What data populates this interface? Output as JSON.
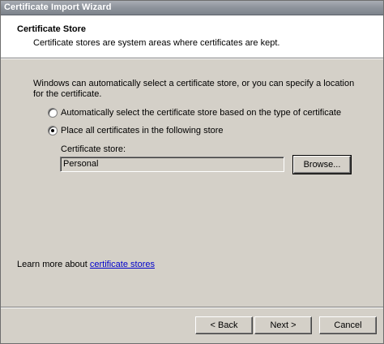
{
  "window": {
    "title": "Certificate Import Wizard"
  },
  "header": {
    "title": "Certificate Store",
    "description": "Certificate stores are system areas where certificates are kept."
  },
  "main": {
    "intro": "Windows can automatically select a certificate store, or you can specify a location for the certificate.",
    "options": [
      {
        "label": "Automatically select the certificate store based on the type of certificate",
        "selected": false
      },
      {
        "label": "Place all certificates in the following store",
        "selected": true
      }
    ],
    "store_label": "Certificate store:",
    "store_value": "Personal",
    "browse_label": "Browse..."
  },
  "footer": {
    "learn_prefix": "Learn more about ",
    "learn_link": "certificate stores"
  },
  "buttons": {
    "back": "< Back",
    "next": "Next >",
    "cancel": "Cancel"
  }
}
